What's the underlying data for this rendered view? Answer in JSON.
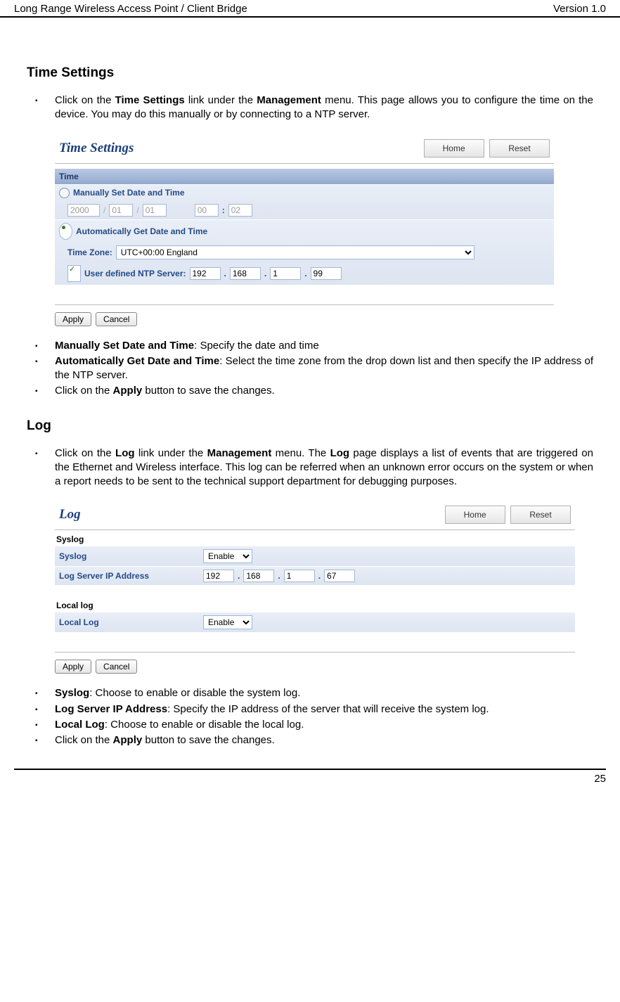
{
  "header": {
    "left": "Long Range Wireless Access Point / Client Bridge",
    "right": "Version 1.0"
  },
  "section1": {
    "title": "Time Settings",
    "intro_prefix": "Click on the ",
    "intro_b1": "Time Settings",
    "intro_mid": " link under the ",
    "intro_b2": "Management",
    "intro_suffix": " menu. This page allows you to configure the time on the device. You may do this manually or by connecting to a NTP server.",
    "panel_title": "Time Settings",
    "nav_home": "Home",
    "nav_reset": "Reset",
    "bar_time": "Time",
    "lbl_manual": "Manually Set Date and Time",
    "date_year": "2000",
    "date_mon": "01",
    "date_day": "01",
    "time_hh": "00",
    "time_mm": "02",
    "lbl_auto": "Automatically Get Date and Time",
    "lbl_tz": "Time Zone:",
    "tz_val": "UTC+00:00 England",
    "lbl_ntp": "User defined NTP Server:",
    "ntp": {
      "a": "192",
      "b": "168",
      "c": "1",
      "d": "99"
    },
    "btn_apply": "Apply",
    "btn_cancel": "Cancel",
    "post": {
      "p1_b": "Manually Set Date and Time",
      "p1_t": ": Specify the date and time",
      "p2_b": "Automatically Get Date and Time",
      "p2_t": ": Select the time zone from the drop down list and then specify the IP address of the NTP server.",
      "p3_pre": "Click on the ",
      "p3_b": "Apply",
      "p3_suf": " button to save the changes."
    }
  },
  "section2": {
    "title": "Log",
    "intro_pre": "Click on the ",
    "intro_b1": "Log",
    "intro_mid1": " link under the ",
    "intro_b2": "Management",
    "intro_mid2": " menu. The ",
    "intro_b3": "Log",
    "intro_suf": " page displays a list of events that are triggered on the Ethernet and Wireless interface. This log can be referred when an unknown error occurs on the system or when a report needs to be sent to the technical support department for debugging purposes.",
    "panel_title": "Log",
    "nav_home": "Home",
    "nav_reset": "Reset",
    "lbl_syslog_sec": "Syslog",
    "lbl_syslog": "Syslog",
    "syslog_val": "Enable",
    "lbl_ip": "Log Server IP Address",
    "ip": {
      "a": "192",
      "b": "168",
      "c": "1",
      "d": "67"
    },
    "lbl_local_sec": "Local log",
    "lbl_local": "Local Log",
    "local_val": "Enable",
    "btn_apply": "Apply",
    "btn_cancel": "Cancel",
    "post": {
      "p1_b": "Syslog",
      "p1_t": ": Choose to enable or disable the system log.",
      "p2_b": "Log Server IP Address",
      "p2_t": ": Specify the IP address of the server that will receive the system log.",
      "p3_b": "Local Log",
      "p3_t": ": Choose to enable or disable the local log.",
      "p4_pre": "Click on the ",
      "p4_b": "Apply",
      "p4_suf": " button to save the changes."
    }
  },
  "footer": {
    "page": "25"
  }
}
